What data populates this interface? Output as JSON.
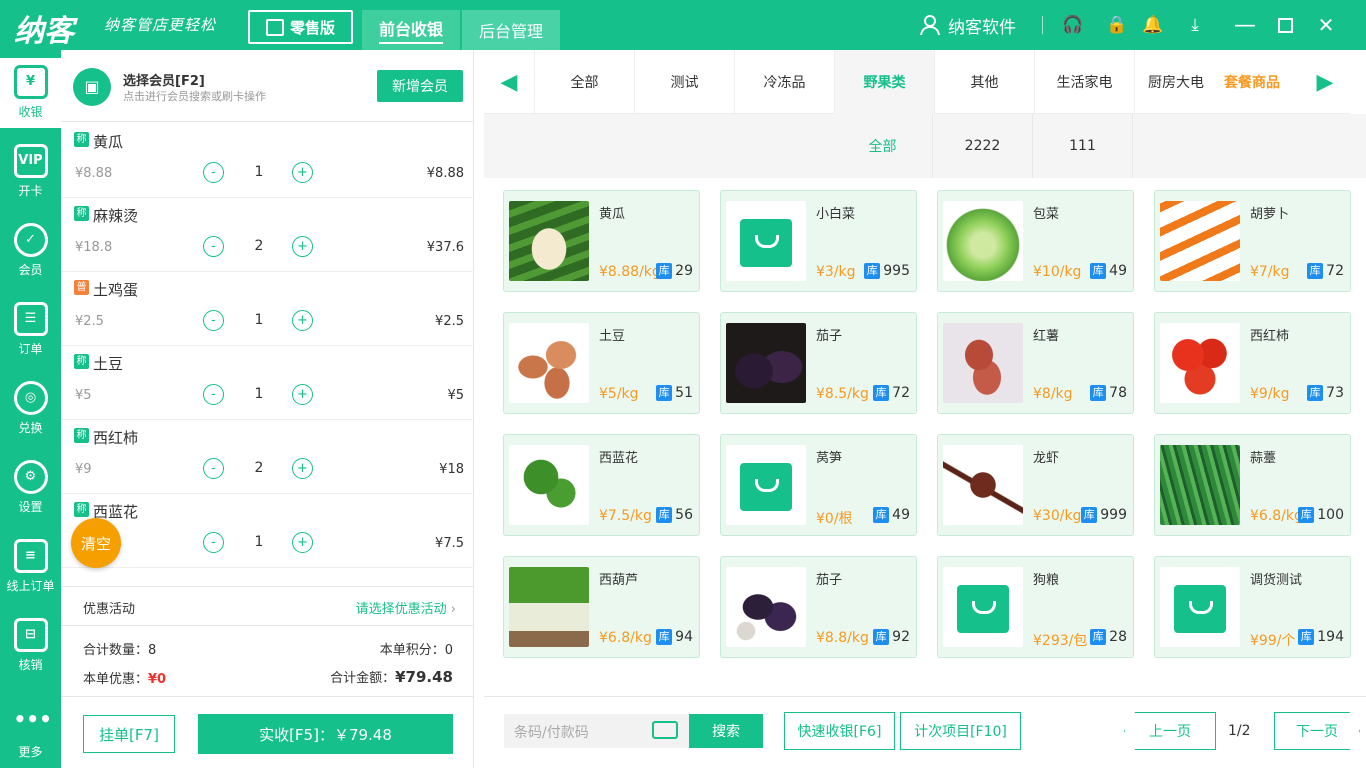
{
  "app": {
    "logo": "纳客",
    "slogan": "纳客管店更轻松",
    "retail_label": "零售版",
    "tabs": [
      "前台收银",
      "后台管理"
    ],
    "user": "纳客软件"
  },
  "nav": [
    "收银",
    "开卡",
    "会员",
    "订单",
    "兑换",
    "设置",
    "线上订单",
    "核销",
    "更多"
  ],
  "member": {
    "title": "选择会员[F2]",
    "sub": "点击进行会员搜索或刷卡操作",
    "add": "新增会员"
  },
  "cart": [
    {
      "tag": "称",
      "name": "黄瓜",
      "price": "¥8.88",
      "qty": "1",
      "total": "¥8.88"
    },
    {
      "tag": "称",
      "name": "麻辣烫",
      "price": "¥18.8",
      "qty": "2",
      "total": "¥37.6"
    },
    {
      "tag": "普",
      "name": "土鸡蛋",
      "price": "¥2.5",
      "qty": "1",
      "total": "¥2.5"
    },
    {
      "tag": "称",
      "name": "土豆",
      "price": "¥5",
      "qty": "1",
      "total": "¥5"
    },
    {
      "tag": "称",
      "name": "西红柿",
      "price": "¥9",
      "qty": "2",
      "total": "¥18"
    },
    {
      "tag": "称",
      "name": "西蓝花",
      "price": "¥7.5",
      "qty": "1",
      "total": "¥7.5"
    }
  ],
  "clear": "清空",
  "promo": {
    "label": "优惠活动",
    "select": "请选择优惠活动"
  },
  "summary": {
    "count_label": "合计数量：",
    "count": "8",
    "points_label": "本单积分：",
    "points": "0",
    "discount_label": "本单优惠：",
    "discount": "¥0",
    "amount_label": "合计金额：",
    "amount": "¥79.48"
  },
  "buttons": {
    "hold": "挂单[F7]",
    "pay": "实收[F5]：￥79.48"
  },
  "categories": [
    "全部",
    "测试",
    "冷冻品",
    "野果类",
    "其他",
    "生活家电",
    "厨房大电",
    "套餐商品"
  ],
  "subcategories": [
    "全部",
    "2222",
    "111"
  ],
  "products": [
    {
      "name": "黄瓜",
      "price": "¥8.88/kg",
      "stock": "29",
      "img": "cucumber"
    },
    {
      "name": "小白菜",
      "price": "¥3/kg",
      "stock": "995",
      "img": "bag"
    },
    {
      "name": "包菜",
      "price": "¥10/kg",
      "stock": "49",
      "img": "cabbage"
    },
    {
      "name": "胡萝卜",
      "price": "¥7/kg",
      "stock": "72",
      "img": "carrot"
    },
    {
      "name": "土豆",
      "price": "¥5/kg",
      "stock": "51",
      "img": "potato"
    },
    {
      "name": "茄子",
      "price": "¥8.5/kg",
      "stock": "72",
      "img": "eggplant"
    },
    {
      "name": "红薯",
      "price": "¥8/kg",
      "stock": "78",
      "img": "sweetpotato"
    },
    {
      "name": "西红柿",
      "price": "¥9/kg",
      "stock": "73",
      "img": "tomato"
    },
    {
      "name": "西蓝花",
      "price": "¥7.5/kg",
      "stock": "56",
      "img": "broccoli"
    },
    {
      "name": "莴笋",
      "price": "¥0/根",
      "stock": "49",
      "img": "bag"
    },
    {
      "name": "龙虾",
      "price": "¥30/kg",
      "stock": "999",
      "img": "lobster"
    },
    {
      "name": "蒜薹",
      "price": "¥6.8/kg",
      "stock": "100",
      "img": "garlic"
    },
    {
      "name": "西葫芦",
      "price": "¥6.8/kg",
      "stock": "94",
      "img": "zucchini"
    },
    {
      "name": "茄子",
      "price": "¥8.8/kg",
      "stock": "92",
      "img": "eggplant2"
    },
    {
      "name": "狗粮",
      "price": "¥293/包",
      "stock": "28",
      "img": "bag"
    },
    {
      "name": "调货测试",
      "price": "¥99/个",
      "stock": "194",
      "img": "bag"
    }
  ],
  "stock_label": "库",
  "bottom": {
    "placeholder": "条码/付款码",
    "search": "搜索",
    "quick": "快速收银[F6]",
    "count_item": "计次项目[F10]",
    "prev": "上一页",
    "page": "1/2",
    "next": "下一页"
  }
}
